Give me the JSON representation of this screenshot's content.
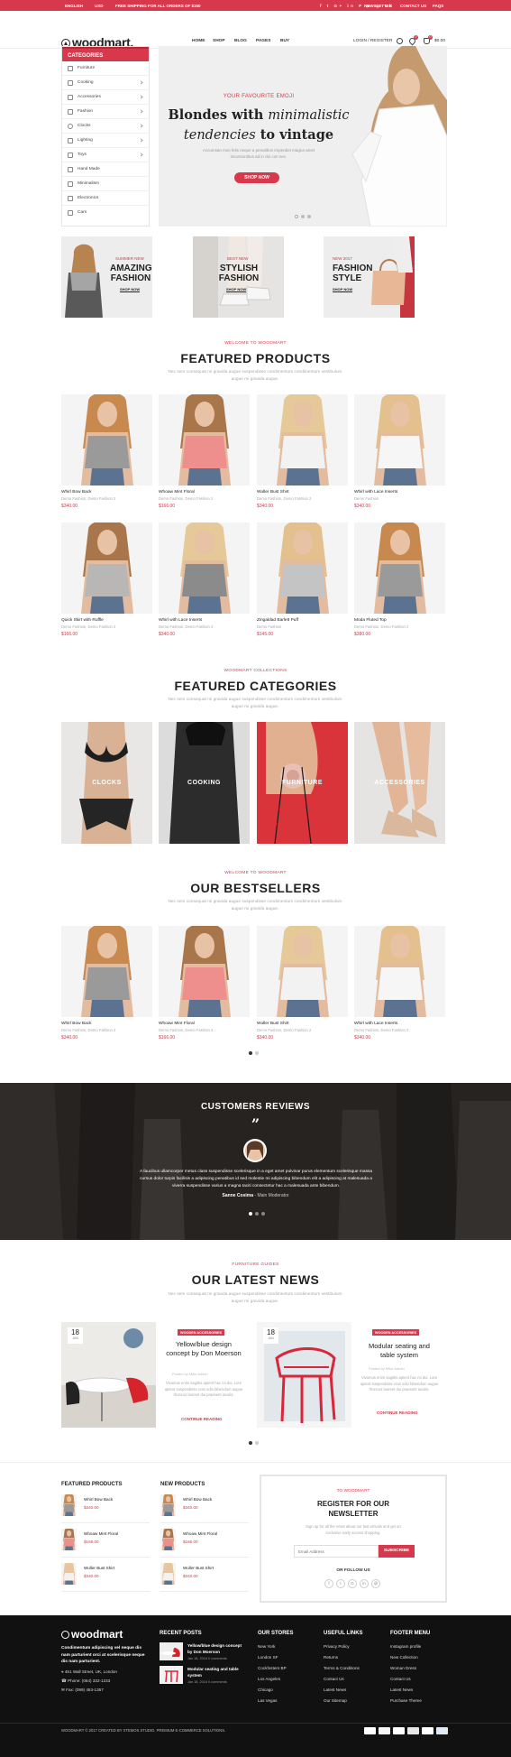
{
  "topbar": {
    "language": "ENGLISH",
    "currency": "USD",
    "shipping": "FREE SHIPPING FOR ALL ORDERS OF $150",
    "newsletter": "NEWSLETTER",
    "contact": "CONTACT US",
    "faqs": "FAQS",
    "social_icons": [
      "facebook-icon",
      "twitter-icon",
      "google-plus-icon",
      "linkedin-icon",
      "pinterest-icon",
      "youtube-icon",
      "instagram-icon",
      "vk-icon"
    ]
  },
  "header": {
    "logo": "woodmart.",
    "nav": [
      "HOME",
      "SHOP",
      "BLOG",
      "PAGES",
      "BUY"
    ],
    "login": "LOGIN / REGISTER",
    "wishlist_count": "0",
    "cart_count": "0",
    "cart_total": "$0.00"
  },
  "sidebar": {
    "title": "CATEGORIES",
    "items": [
      "Furniture",
      "Cooking",
      "Accessories",
      "Fashion",
      "Clocks",
      "Lighting",
      "Toys",
      "Hand Made",
      "Minimalism",
      "Electronics",
      "Cars"
    ]
  },
  "hero": {
    "eyebrow": "YOUR FAVOURITE EMOJI",
    "line1_plain": "Blondes with ",
    "line1_italic": "minimalistic",
    "line2_italic": "tendencies",
    "line2_plain": " to vintage",
    "text": "Accumsan mus felis neque a penatibus imperdiet magna amet incursionibus ad in dui con nec.",
    "button": "SHOP NOW"
  },
  "promos": [
    {
      "eyebrow": "SUMMER NEW",
      "title1": "AMAZING",
      "title2": "FASHION",
      "cta": "SHOP NOW"
    },
    {
      "eyebrow": "BEST NEW",
      "title1": "STYLISH",
      "title2": "FASHION",
      "cta": "SHOP NOW"
    },
    {
      "eyebrow": "NEW 2017",
      "title1": "FASHION",
      "title2": "STYLE",
      "cta": "SHOP NOW"
    }
  ],
  "featured": {
    "subtitle": "WELCOME TO WOODMART",
    "title": "FEATURED PRODUCTS",
    "desc": "Nec sem consequat mi gravida augue suspendisse condimentum condimentum vestibulum augue mi gravida augue.",
    "products": [
      {
        "name": "Whirl Bow Back",
        "cats": "Demo Fashion, Demo Fashion 2",
        "price": "$340.00"
      },
      {
        "name": "Whoaw Mint Floral",
        "cats": "Demo Fashion, Demo Fashion 2",
        "price": "$166.00"
      },
      {
        "name": "Wuller Bust Shirt",
        "cats": "Demo Fashion, Demo Fashion 2",
        "price": "$340.00"
      },
      {
        "name": "Whirl with Lace Inserts",
        "cats": "Demo Fashion",
        "price": "$340.00"
      },
      {
        "name": "Quick Skirt with Ruffle",
        "cats": "Demo Fashion, Demo Fashion 2",
        "price": "$166.00"
      },
      {
        "name": "Whirl with Lace Inserts",
        "cats": "Demo Fashion, Demo Fashion 2",
        "price": "$340.00"
      },
      {
        "name": "Zingaldad Barlett Puff",
        "cats": "Demo Fashion",
        "price": "$145.00"
      },
      {
        "name": "Moda Fluted Top",
        "cats": "Demo Fashion, Demo Fashion 2",
        "price": "$380.00"
      }
    ]
  },
  "categories": {
    "subtitle": "WOODMART COLLECTIONS",
    "title": "FEATURED CATEGORIES",
    "desc": "Nec sem consequat mi gravida augue suspendisse condimentum condimentum vestibulum augue mi gravida augue.",
    "items": [
      "CLOCKS",
      "COOKING",
      "FURNITURE",
      "ACCESSORIES"
    ]
  },
  "bestsellers": {
    "subtitle": "WELCOME TO WOODMART",
    "title": "OUR BESTSELLERS",
    "desc": "Nec sem consequat mi gravida augue suspendisse condimentum condimentum vestibulum augue mi gravida augue.",
    "products": [
      {
        "name": "Whirl Bow Back",
        "cats": "Demo Fashion, Demo Fashion 2",
        "price": "$340.00"
      },
      {
        "name": "Whoaw Mint Floral",
        "cats": "Demo Fashion, Demo Fashion 2",
        "price": "$166.00"
      },
      {
        "name": "Wuller Bust Shirt",
        "cats": "Demo Fashion, Demo Fashion 2",
        "price": "$340.00"
      },
      {
        "name": "Whirl with Lace Inserts",
        "cats": "Demo Fashion, Demo Fashion 2",
        "price": "$340.00"
      }
    ]
  },
  "reviews": {
    "title": "CUSTOMERS REVIEWS",
    "text": "A faucibus ullamcorper metus class suspendisse scelerisque in a eget amet pulvinar purus elementum scelerisque massa cursus dolor turpis facilisis a adipiscing penatibus id sed molestie mi adipiscing bibendum elit a adipiscing at malesuada a viverra suspendisse varius a magna taciti consectetur hac a malesuada ante bibendum.",
    "author": "Sanne Cosima",
    "role": "- Main Moderator"
  },
  "news": {
    "subtitle": "FURNITURE GUIDES",
    "title": "OUR LATEST NEWS",
    "desc": "Nec sem consequat mi gravida augue suspendisse condimentum condimentum vestibulum augue mi gravida augue.",
    "posts": [
      {
        "day": "18",
        "month": "JAN",
        "cat": "WOODEN ACCESSORIES",
        "title": "Yellow/blue design concept by Don Moerson",
        "meta": "Posted by Mike Admin",
        "excerpt": "Vivamus enim sagittis aptent hac mi dui. Lore aptent suspendisse cras odio bibendum augue rhoncus laoreet dui praesent iaculis.",
        "more": "CONTINUE READING"
      },
      {
        "day": "18",
        "month": "JAN",
        "cat": "WOODEN ACCESSORIES",
        "title": "Modular seating and table system",
        "meta": "Posted by Mike Admin",
        "excerpt": "Vivamus enim sagittis aptent hac mi dui. Lore aptent suspendisse cras odio bibendum augue rhoncus laoreet dui praesent iaculis.",
        "more": "CONTINUE READING"
      }
    ]
  },
  "mini_lists": {
    "featured_title": "FEATURED PRODUCTS",
    "new_title": "NEW PRODUCTS",
    "featured": [
      {
        "name": "Whirl Bow Back",
        "price": "$340.00"
      },
      {
        "name": "Whoaw Mint Floral",
        "price": "$166.00"
      },
      {
        "name": "Wuller Bust Shirt",
        "price": "$340.00"
      }
    ],
    "new": [
      {
        "name": "Whirl Bow Back",
        "price": "$340.00"
      },
      {
        "name": "Whoaw Mint Floral",
        "price": "$166.00"
      },
      {
        "name": "Wuller Bust Shirt",
        "price": "$340.00"
      }
    ]
  },
  "newsletter": {
    "eyebrow": "TO WOODMART",
    "title1": "REGISTER FOR OUR",
    "title2": "NEWSLETTER",
    "text": "Sign up for all the news about our last arrivals and get an exclusive early access shopping.",
    "placeholder": "Email Address",
    "button": "SUBSCRIBE",
    "follow": "OR FOLLOW US"
  },
  "footer": {
    "logo": "woodmart",
    "about": "Condimentum adipiscing vel neque dis nam parturient orci at scelerisque neque dis nam parturient.",
    "address": "451 Wall Street, UK, London",
    "phone": "Phone: (064) 332-1233",
    "fax": "Fax: (099) 453-1357",
    "recent_title": "RECENT POSTS",
    "recent": [
      {
        "title": "Yellow/blue design concept by Don Moerson",
        "date": "Jan 18, 2016  0 comments"
      },
      {
        "title": "Modular seating and table system",
        "date": "Jan 18, 2016  0 comments"
      }
    ],
    "stores_title": "OUR STORES",
    "stores": [
      "New York",
      "London SF",
      "Cockfosters BP",
      "Los Angeles",
      "Chicago",
      "Las Vegas"
    ],
    "links_title": "USEFUL LINKS",
    "links": [
      "Privacy Policy",
      "Returns",
      "Terms & Conditions",
      "Contact Us",
      "Latest News",
      "Our Sitemap"
    ],
    "menu_title": "FOOTER MENU",
    "menu": [
      "Instagram profile",
      "New Collection",
      "Woman Dress",
      "Contact Us",
      "Latest News",
      "Purchase Theme"
    ],
    "copyright": "WOODMART © 2017 CREATED BY  XTEMOS STUDIO. PREMIUM E-COMMERCE SOLUTIONS."
  },
  "colors": {
    "accent": "#d8384b",
    "dark": "#111111",
    "review_bg": "#3a3533"
  }
}
